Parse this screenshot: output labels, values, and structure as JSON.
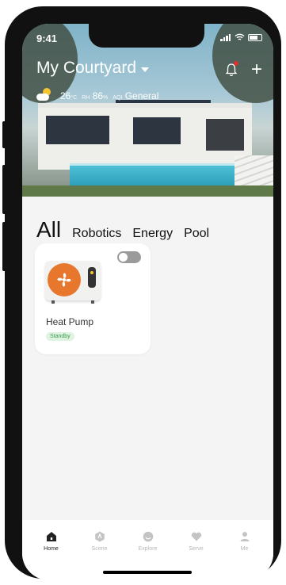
{
  "status_bar": {
    "time": "9:41"
  },
  "header": {
    "title": "My Courtyard",
    "weather": {
      "temp": "26",
      "temp_unit": "°C",
      "rh_label": "RH",
      "rh_value": "86",
      "rh_unit": "%",
      "aq_label": "AQI",
      "aq_value": "General"
    }
  },
  "tabs": [
    "All",
    "Robotics",
    "Energy",
    "Pool"
  ],
  "device": {
    "name": "Heat Pump",
    "status": "Standby",
    "power_on": false
  },
  "nav": [
    {
      "label": "Home",
      "icon": "home-icon",
      "active": true
    },
    {
      "label": "Scene",
      "icon": "scene-icon",
      "active": false
    },
    {
      "label": "Explore",
      "icon": "explore-icon",
      "active": false
    },
    {
      "label": "Serve",
      "icon": "heart-icon",
      "active": false
    },
    {
      "label": "Me",
      "icon": "user-icon",
      "active": false
    }
  ]
}
